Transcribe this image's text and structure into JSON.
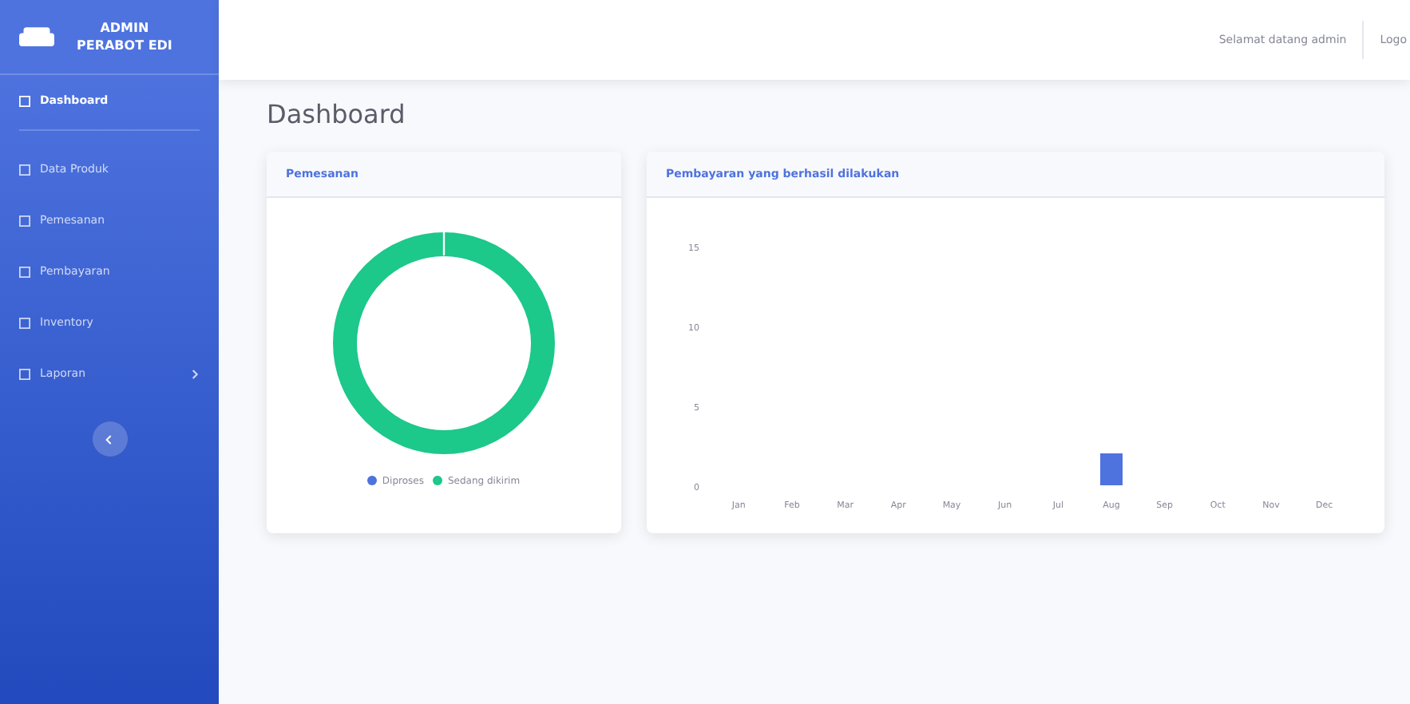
{
  "sidebar": {
    "brand": [
      "ADMIN",
      "PERABOT EDI"
    ],
    "items": [
      {
        "label": "Dashboard",
        "selected": true,
        "has_arrow": false
      },
      {
        "label": "Data Produk",
        "selected": false,
        "has_arrow": false
      },
      {
        "label": "Pemesanan",
        "selected": false,
        "has_arrow": false
      },
      {
        "label": "Pembayaran",
        "selected": false,
        "has_arrow": false
      },
      {
        "label": "Inventory",
        "selected": false,
        "has_arrow": false
      },
      {
        "label": "Laporan",
        "selected": false,
        "has_arrow": true
      }
    ]
  },
  "topbar": {
    "greeting": "Selamat datang admin",
    "logout": "Logo"
  },
  "page_title": "Dashboard",
  "orders_card": {
    "title": "Pemesanan",
    "legend": [
      {
        "label": "Diproses",
        "color": "#4e73df"
      },
      {
        "label": "Sedang dikirim",
        "color": "#1cc88a"
      }
    ]
  },
  "payments_card": {
    "title": "Pembayaran yang berhasil dilakukan",
    "chart_data": {
      "type": "bar",
      "categories": [
        "Jan",
        "Feb",
        "Mar",
        "Apr",
        "May",
        "Jun",
        "Jul",
        "Aug",
        "Sep",
        "Oct",
        "Nov",
        "Dec"
      ],
      "series": [
        {
          "color": "#4e73df",
          "values": [
            0,
            0,
            0,
            0,
            0,
            0,
            0,
            2,
            0,
            0,
            0,
            0
          ]
        }
      ],
      "ylim": [
        0,
        15
      ],
      "yticks": [
        0,
        5,
        10,
        15
      ]
    }
  }
}
